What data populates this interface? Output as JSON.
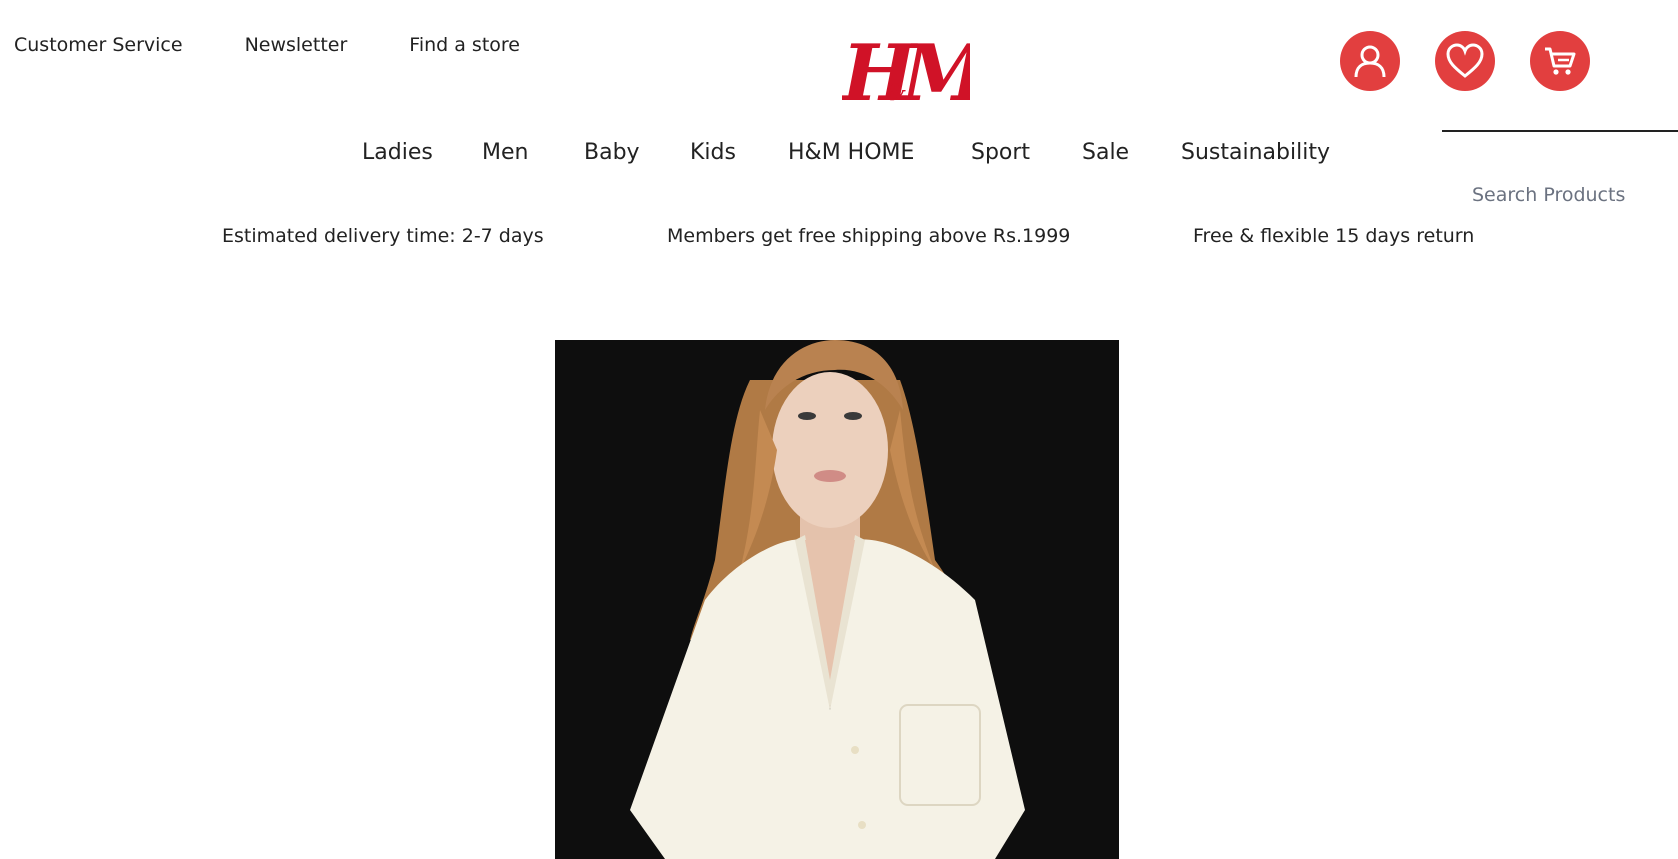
{
  "utility_nav": {
    "customer_service": "Customer Service",
    "newsletter": "Newsletter",
    "find_store": "Find a store"
  },
  "logo": {
    "text": "H&M",
    "color": "#d01227"
  },
  "header_icons": [
    {
      "name": "account-icon"
    },
    {
      "name": "heart-icon"
    },
    {
      "name": "cart-icon"
    }
  ],
  "accent_color": "#e23f3f",
  "search": {
    "placeholder": "Search Products"
  },
  "main_nav": {
    "items": [
      {
        "label": "Ladies"
      },
      {
        "label": "Men"
      },
      {
        "label": "Baby"
      },
      {
        "label": "Kids"
      },
      {
        "label": "H&M HOME"
      },
      {
        "label": "Sport"
      },
      {
        "label": "Sale"
      },
      {
        "label": "Sustainability"
      }
    ]
  },
  "promo_bar": {
    "delivery": "Estimated delivery time: 2-7 days",
    "shipping": "Members get free shipping above Rs.1999",
    "returns": "Free & flexible 15 days return"
  }
}
